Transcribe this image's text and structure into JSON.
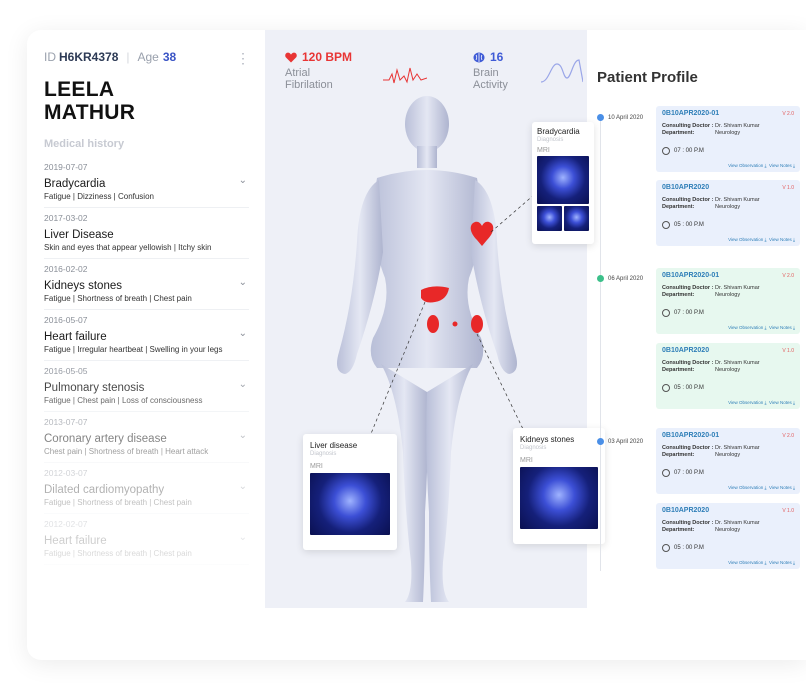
{
  "patient": {
    "id_label": "ID",
    "id": "H6KR4378",
    "age_label": "Age",
    "age": "38",
    "name_line1": "LEELA",
    "name_line2": "MATHUR",
    "history_title": "Medical history"
  },
  "history": [
    {
      "date": "2019-07-07",
      "title": "Bradycardia",
      "symptoms": "Fatigue | Dizziness | Confusion"
    },
    {
      "date": "2017-03-02",
      "title": "Liver Disease",
      "symptoms": "Skin and eyes that appear yellowish | Itchy skin"
    },
    {
      "date": "2016-02-02",
      "title": "Kidneys stones",
      "symptoms": "Fatigue | Shortness of breath | Chest pain"
    },
    {
      "date": "2016-05-07",
      "title": "Heart failure",
      "symptoms": "Fatigue | Irregular heartbeat | Swelling in your legs"
    },
    {
      "date": "2016-05-05",
      "title": "Pulmonary stenosis",
      "symptoms": "Fatigue | Chest pain | Loss of consciousness"
    },
    {
      "date": "2013-07-07",
      "title": "Coronary artery disease",
      "symptoms": "Chest pain | Shortness of breath | Heart attack"
    },
    {
      "date": "2012-03-07",
      "title": "Dilated cardiomyopathy",
      "symptoms": "Fatigue | Shortness of breath | Chest pain"
    },
    {
      "date": "2012-02-07",
      "title": "Heart failure",
      "symptoms": "Fatigue | Shortness of breath | Chest pain"
    }
  ],
  "vitals": {
    "heart": {
      "value": "120 BPM",
      "label1": "Atrial",
      "label2": "Fibrilation",
      "color": "#e83535"
    },
    "brain": {
      "value": "16",
      "label1": "Brain",
      "label2": "Activity",
      "color": "#3f5bd6"
    }
  },
  "popups": {
    "bradycardia": {
      "title": "Bradycardia",
      "sub": "Diagnosis",
      "mri": "MRI"
    },
    "liver": {
      "title": "Liver disease",
      "sub": "Diagnosis",
      "mri": "MRI"
    },
    "kidneys": {
      "title": "Kidneys stones",
      "sub": "Diagnosis",
      "mri": "MRI"
    }
  },
  "profile": {
    "title": "Patient Profile",
    "groups": [
      {
        "date": "10 April 2020",
        "dot_color": "#4a8fe7"
      },
      {
        "date": "06 April 2020",
        "dot_color": "#3cc08a"
      },
      {
        "date": "03 April 2020",
        "dot_color": "#4a8fe7"
      }
    ],
    "entries": [
      {
        "id": "0B10APR2020-01",
        "ver": "V 2.0",
        "doctor_key": "Consulting Doctor :",
        "doctor": "Dr. Shivam Kumar",
        "dept_key": "Department:",
        "dept": "Neurology",
        "time": "07 : 00 P.M",
        "link1": "View Observation",
        "link2": "View Notes"
      },
      {
        "id": "0B10APR2020",
        "ver": "V 1.0",
        "doctor_key": "Consulting Doctor :",
        "doctor": "Dr. Shivam Kumar",
        "dept_key": "Department:",
        "dept": "Neurology",
        "time": "05 : 00 P.M",
        "link1": "View Observation",
        "link2": "View Notes"
      },
      {
        "id": "0B10APR2020-01",
        "ver": "V 2.0",
        "doctor_key": "Consulting Doctor :",
        "doctor": "Dr. Shivam Kumar",
        "dept_key": "Department:",
        "dept": "Neurology",
        "time": "07 : 00 P.M",
        "link1": "View Observation",
        "link2": "View Notes"
      },
      {
        "id": "0B10APR2020",
        "ver": "V 1.0",
        "doctor_key": "Consulting Doctor :",
        "doctor": "Dr. Shivam Kumar",
        "dept_key": "Department:",
        "dept": "Neurology",
        "time": "05 : 00 P.M",
        "link1": "View Observation",
        "link2": "View Notes"
      },
      {
        "id": "0B10APR2020-01",
        "ver": "V 2.0",
        "doctor_key": "Consulting Doctor :",
        "doctor": "Dr. Shivam Kumar",
        "dept_key": "Department:",
        "dept": "Neurology",
        "time": "07 : 00 P.M",
        "link1": "View Observation",
        "link2": "View Notes"
      },
      {
        "id": "0B10APR2020",
        "ver": "V 1.0",
        "doctor_key": "Consulting Doctor :",
        "doctor": "Dr. Shivam Kumar",
        "dept_key": "Department:",
        "dept": "Neurology",
        "time": "05 : 00 P.M",
        "link1": "View Observation",
        "link2": "View Notes"
      }
    ]
  }
}
